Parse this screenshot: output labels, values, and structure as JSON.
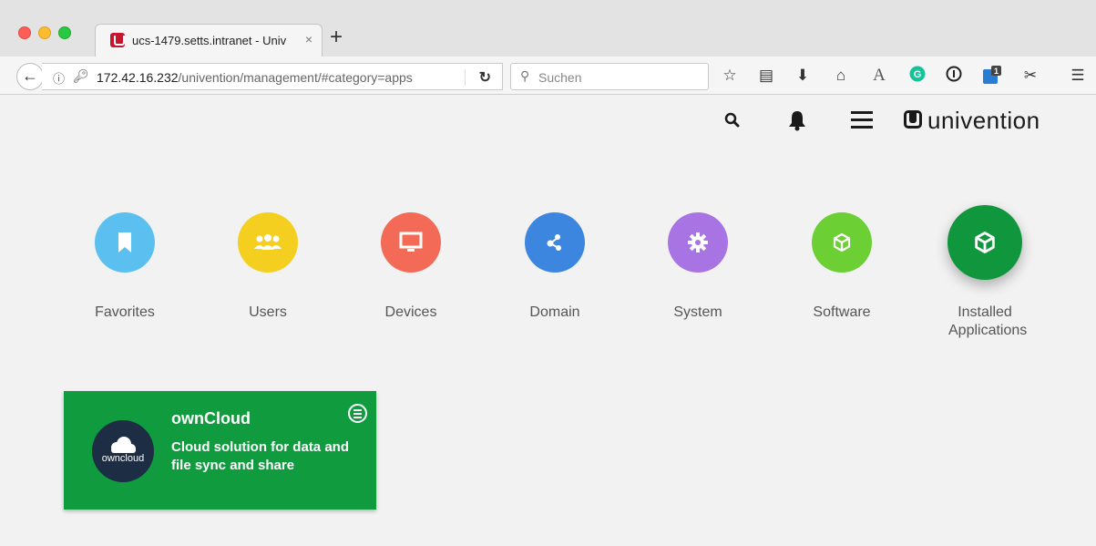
{
  "browser": {
    "tab_title": "ucs-1479.setts.intranet - Univ",
    "tab_close": "×",
    "new_tab": "+",
    "url_host": "172.42.16.232",
    "url_path": "/univention/management/#category=apps",
    "search_placeholder": "Suchen",
    "notification_badge": "1"
  },
  "header": {
    "logo_text": "univention"
  },
  "categories": [
    {
      "label": "Favorites",
      "color": "#5bc0f0",
      "icon": "bookmark-icon"
    },
    {
      "label": "Users",
      "color": "#f4cf1f",
      "icon": "users-icon"
    },
    {
      "label": "Devices",
      "color": "#f36a57",
      "icon": "monitor-icon"
    },
    {
      "label": "Domain",
      "color": "#3d86e0",
      "icon": "network-icon"
    },
    {
      "label": "System",
      "color": "#a874e3",
      "icon": "gear-icon"
    },
    {
      "label": "Software",
      "color": "#6ccf34",
      "icon": "package-icon"
    },
    {
      "label": "Installed Applications",
      "color": "#10963c",
      "icon": "package-icon",
      "selected": true
    }
  ],
  "app": {
    "name": "ownCloud",
    "description": "Cloud solution for data and file sync and share",
    "logo_text": "owncloud",
    "tile_color": "#0f9b3e"
  }
}
